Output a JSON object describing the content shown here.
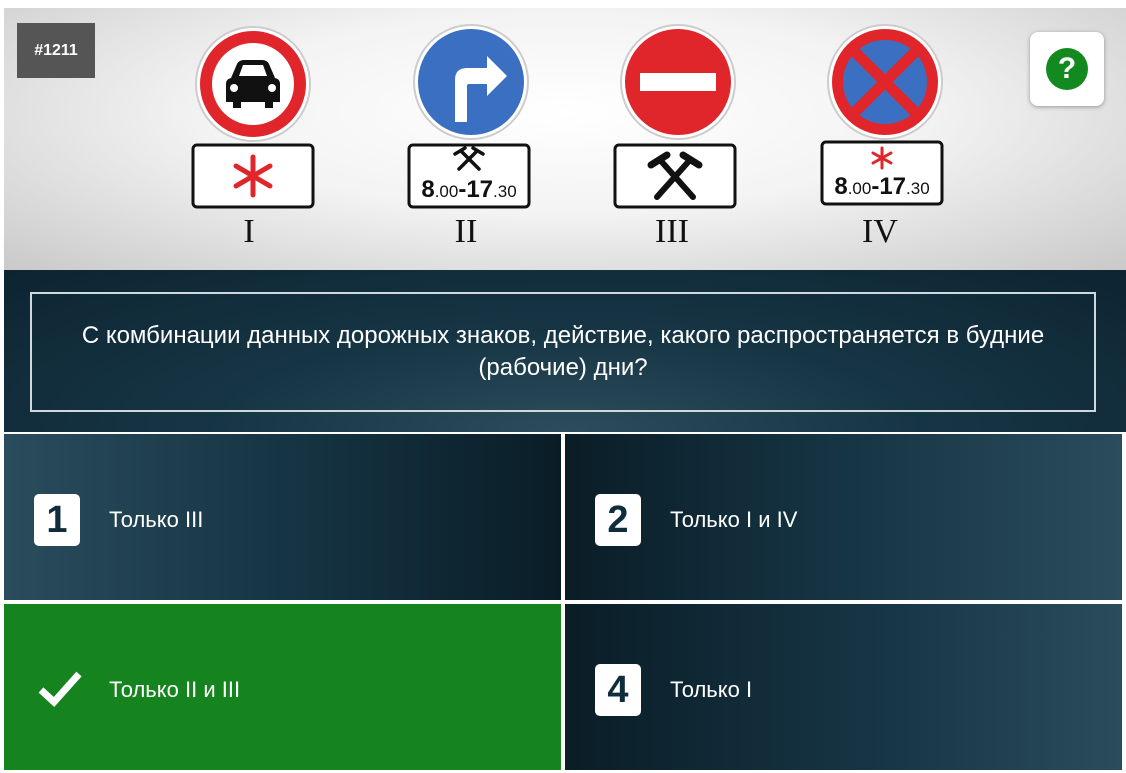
{
  "question_id": "#1211",
  "help_icon": "question-mark-icon",
  "signs": [
    {
      "roman": "I",
      "sign": "no-motor-vehicles",
      "plate": "asterisk"
    },
    {
      "roman": "II",
      "sign": "direction-right",
      "plate": "hammers-time",
      "plate_time": {
        "from_h": "8",
        "from_m": ".00",
        "to_h": "-17",
        "to_m": ".30"
      }
    },
    {
      "roman": "III",
      "sign": "no-entry",
      "plate": "hammers"
    },
    {
      "roman": "IV",
      "sign": "no-stopping",
      "plate": "asterisk-time",
      "plate_time": {
        "from_h": "8",
        "from_m": ".00",
        "to_h": "-17",
        "to_m": ".30"
      }
    }
  ],
  "question_text": "С комбинации данных дорожных знаков, действие, какого распространяется в будние (рабочие) дни?",
  "answers": [
    {
      "number": "1",
      "text": "Только III",
      "state": "default"
    },
    {
      "number": "2",
      "text": "Только I и IV",
      "state": "default"
    },
    {
      "number": "3",
      "text": "Только II и III",
      "state": "correct"
    },
    {
      "number": "4",
      "text": "Только I",
      "state": "default"
    }
  ],
  "colors": {
    "correct": "#15841f",
    "dark": "#163544",
    "sign_red": "#e0262b",
    "sign_blue": "#3b6fc1"
  }
}
